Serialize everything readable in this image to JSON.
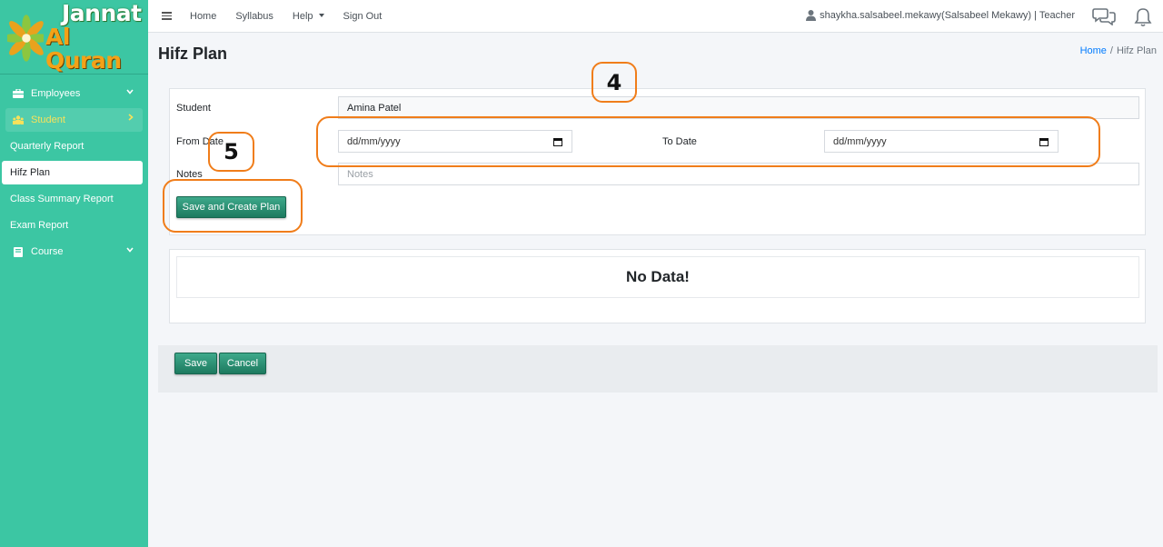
{
  "brand": {
    "line1": "Jannat",
    "line2": "Al Quran"
  },
  "sidebar": {
    "items": [
      {
        "label": "Employees",
        "icon": "briefcase-icon"
      },
      {
        "label": "Student",
        "icon": "users-icon"
      },
      {
        "label": "Quarterly Report"
      },
      {
        "label": "Hifz Plan"
      },
      {
        "label": "Class Summary Report"
      },
      {
        "label": "Exam Report"
      },
      {
        "label": "Course",
        "icon": "book-icon"
      }
    ]
  },
  "topbar": {
    "links": [
      "Home",
      "Syllabus",
      "Help",
      "Sign Out"
    ],
    "user": "shaykha.salsabeel.mekawy(Salsabeel Mekawy) | Teacher"
  },
  "page": {
    "title": "Hifz Plan"
  },
  "breadcrumb": {
    "home": "Home",
    "sep": "/",
    "current": "Hifz Plan"
  },
  "form": {
    "student_label": "Student",
    "student_value": "Amina Patel",
    "from_label": "From Date",
    "from_value": "dd/mm/yyyy",
    "to_label": "To Date",
    "to_value": "dd/mm/yyyy",
    "notes_label": "Notes",
    "notes_placeholder": "Notes",
    "create_button": "Save and Create Plan"
  },
  "table": {
    "empty_text": "No Data!"
  },
  "footer": {
    "save": "Save",
    "cancel": "Cancel"
  },
  "annotations": {
    "a4": "4",
    "a5": "5"
  },
  "colors": {
    "sidebar": "#3cc6a3",
    "accent": "#f07d1a",
    "button": "#2a8d70",
    "link": "#007bff"
  }
}
